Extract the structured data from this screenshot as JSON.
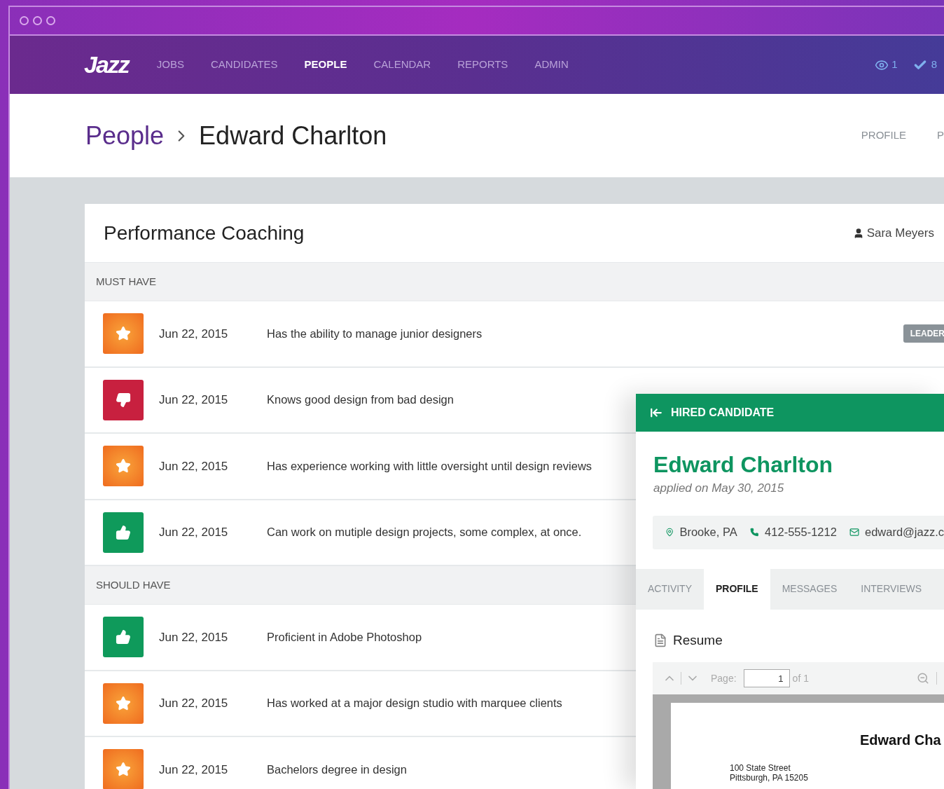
{
  "nav": {
    "logo": "Jazz",
    "items": [
      {
        "label": "JOBS",
        "selected": false
      },
      {
        "label": "CANDIDATES",
        "selected": false
      },
      {
        "label": "PEOPLE",
        "selected": true
      },
      {
        "label": "CALENDAR",
        "selected": false
      },
      {
        "label": "REPORTS",
        "selected": false
      },
      {
        "label": "ADMIN",
        "selected": false
      }
    ],
    "views_count": "1",
    "approvals_count": "8"
  },
  "header": {
    "breadcrumb": "People",
    "title": "Edward Charlton",
    "tabs": [
      {
        "label": "PROFILE",
        "selected": false
      },
      {
        "label": "P",
        "selected": false
      }
    ]
  },
  "card": {
    "title": "Performance Coaching",
    "owner": "Sara Meyers",
    "sections": [
      {
        "label": "MUST HAVE",
        "rows": [
          {
            "kind": "star",
            "date": "Jun 22, 2015",
            "text": "Has the ability to manage junior designers",
            "tag": "LEADER"
          },
          {
            "kind": "thumbs_down",
            "date": "Jun 22, 2015",
            "text": "Knows good design from bad design"
          },
          {
            "kind": "star",
            "date": "Jun 22, 2015",
            "text": "Has experience working with little oversight until design reviews"
          },
          {
            "kind": "thumbs_up",
            "date": "Jun 22, 2015",
            "text": "Can work on mutiple design projects, some complex, at once."
          }
        ]
      },
      {
        "label": "SHOULD HAVE",
        "rows": [
          {
            "kind": "thumbs_up",
            "date": "Jun 22, 2015",
            "text": "Proficient in Adobe Photoshop"
          },
          {
            "kind": "star",
            "date": "Jun 22, 2015",
            "text": "Has worked at a major design studio with marquee clients"
          },
          {
            "kind": "star",
            "date": "Jun 22, 2015",
            "text": "Bachelors degree in design"
          }
        ]
      }
    ]
  },
  "panel": {
    "status": "HIRED CANDIDATE",
    "name": "Edward Charlton",
    "applied": "applied on May 30, 2015",
    "location": "Brooke, PA",
    "phone": "412-555-1212",
    "email": "edward@jazz.c",
    "tabs": [
      {
        "label": "ACTIVITY",
        "selected": false
      },
      {
        "label": "PROFILE",
        "selected": true
      },
      {
        "label": "MESSAGES",
        "selected": false
      },
      {
        "label": "INTERVIEWS",
        "selected": false
      }
    ],
    "resume": {
      "title": "Resume",
      "page_label": "Page:",
      "page": "1",
      "page_total": "of 1",
      "doc_name": "Edward Cha",
      "address": [
        "100 State Street",
        "Pittsburgh, PA 15205"
      ]
    }
  }
}
